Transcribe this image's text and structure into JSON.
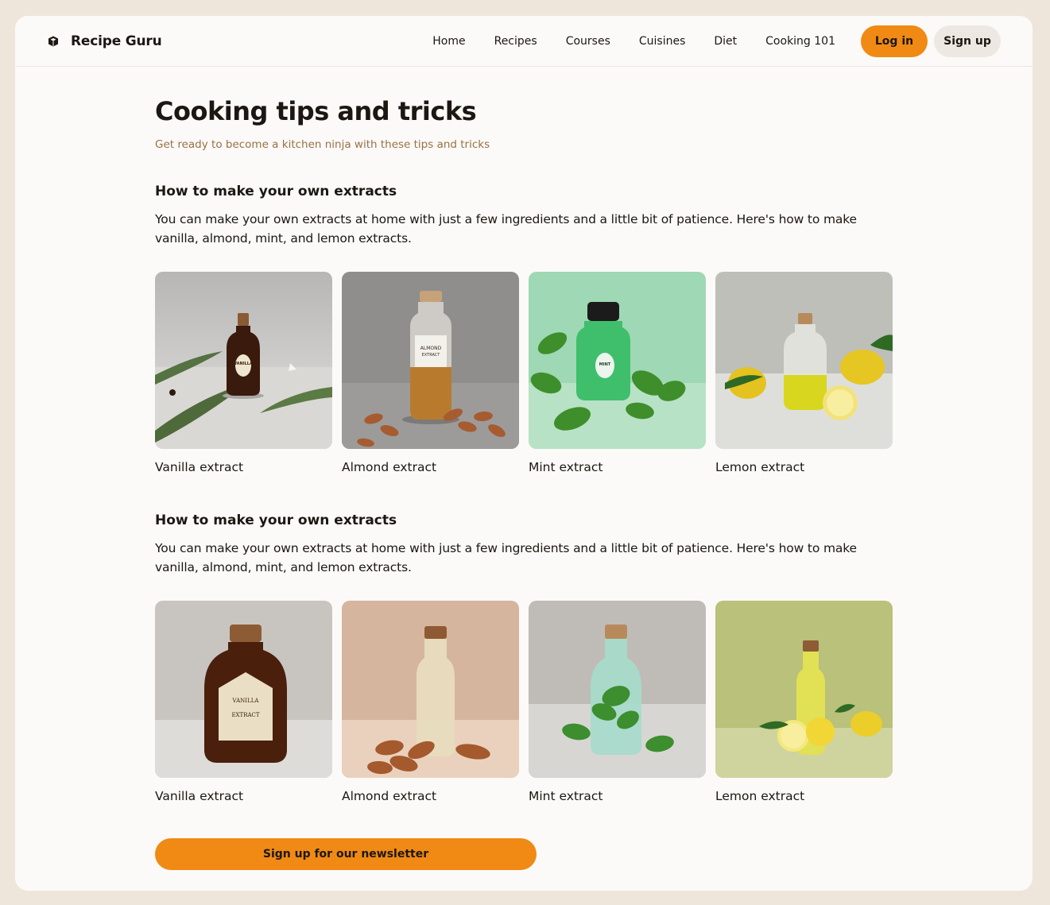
{
  "brand": {
    "name": "Recipe Guru",
    "icon": "box-icon"
  },
  "nav": {
    "links": [
      "Home",
      "Recipes",
      "Courses",
      "Cuisines",
      "Diet",
      "Cooking 101"
    ],
    "login_label": "Log in",
    "signup_label": "Sign up"
  },
  "page": {
    "title": "Cooking tips and tricks",
    "subtitle": "Get ready to become a kitchen ninja with these tips and tricks"
  },
  "sections": [
    {
      "title": "How to make your own extracts",
      "body": "You can make your own extracts at home with just a few ingredients and a little bit of patience. Here's how to make vanilla, almond, mint, and lemon extracts.",
      "cards": [
        {
          "label": "Vanilla extract",
          "image": "vanilla-bottle-image",
          "bottle_label": [
            "VANILLA"
          ]
        },
        {
          "label": "Almond extract",
          "image": "almond-bottle-image",
          "bottle_label": [
            "ALMOND",
            "EXTRACT"
          ]
        },
        {
          "label": "Mint extract",
          "image": "mint-bottle-image",
          "bottle_label": [
            "MINT"
          ]
        },
        {
          "label": "Lemon extract",
          "image": "lemon-bottle-image",
          "bottle_label": []
        }
      ]
    },
    {
      "title": "How to make your own extracts",
      "body": "You can make your own extracts at home with just a few ingredients and a little bit of patience. Here's how to make vanilla, almond, mint, and lemon extracts.",
      "cards": [
        {
          "label": "Vanilla extract",
          "image": "vanilla-bottle-image",
          "bottle_label": [
            "VANILLA",
            "EXTRACT"
          ]
        },
        {
          "label": "Almond extract",
          "image": "almond-bottle-image",
          "bottle_label": []
        },
        {
          "label": "Mint extract",
          "image": "mint-bottle-image",
          "bottle_label": []
        },
        {
          "label": "Lemon extract",
          "image": "lemon-bottle-image",
          "bottle_label": []
        }
      ]
    }
  ],
  "newsletter": {
    "label": "Sign up for our newsletter"
  },
  "colors": {
    "accent": "#f08a14",
    "page_background": "#efe6db",
    "surface": "#fbfaf8",
    "subtitle": "#9b7045",
    "secondary_button": "#eee8e2"
  }
}
